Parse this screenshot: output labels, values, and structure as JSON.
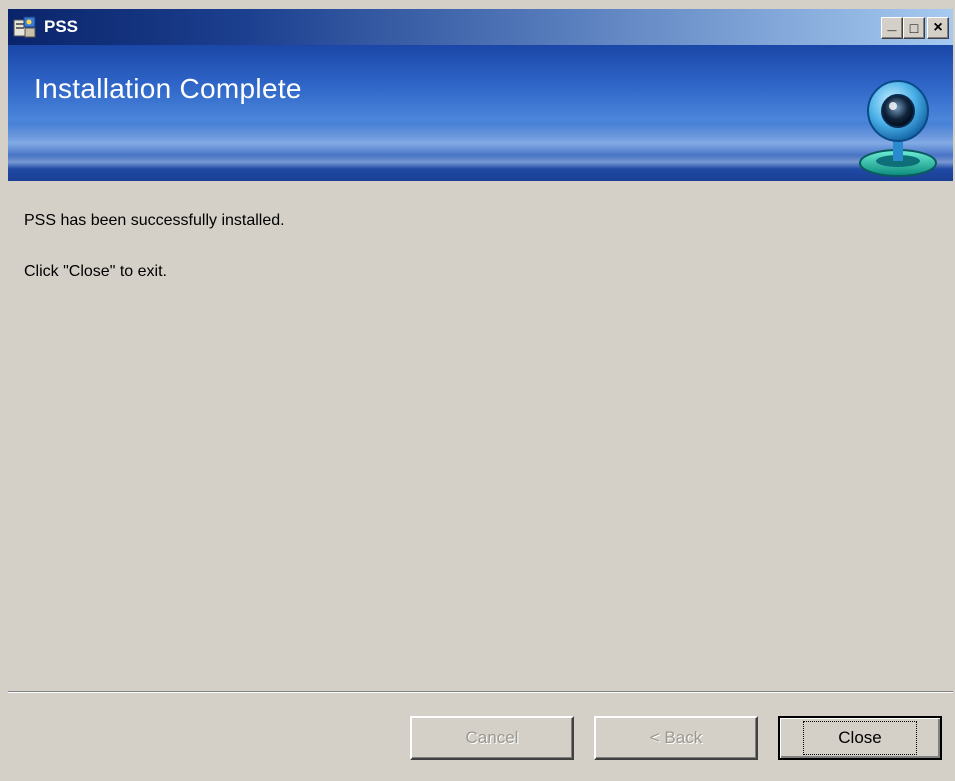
{
  "window": {
    "title": "PSS",
    "controls": {
      "minimize": "_",
      "maximize": "□",
      "close": "×"
    }
  },
  "banner": {
    "title": "Installation Complete",
    "icon": "webcam-icon"
  },
  "content": {
    "line1": "PSS has been successfully installed.",
    "line2": "Click \"Close\" to exit."
  },
  "buttons": {
    "cancel": "Cancel",
    "back": "< Back",
    "close": "Close"
  },
  "colors": {
    "titlebar_start": "#0a246a",
    "titlebar_end": "#a6caf0",
    "banner": "#2f66c8",
    "dialog_bg": "#d4d0c8"
  }
}
